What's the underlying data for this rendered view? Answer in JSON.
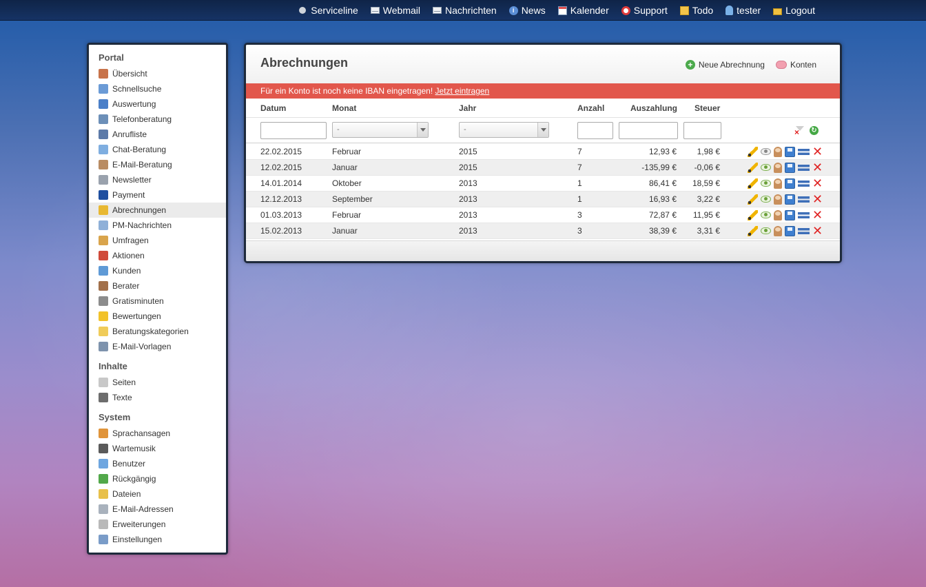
{
  "topnav": [
    {
      "label": "Serviceline",
      "icon": "status-dot-icon"
    },
    {
      "label": "Webmail",
      "icon": "webmail-icon"
    },
    {
      "label": "Nachrichten",
      "icon": "envelope-icon"
    },
    {
      "label": "News",
      "icon": "info-icon"
    },
    {
      "label": "Kalender",
      "icon": "calendar-icon"
    },
    {
      "label": "Support",
      "icon": "lifebuoy-icon"
    },
    {
      "label": "Todo",
      "icon": "note-icon"
    },
    {
      "label": "tester",
      "icon": "user-icon"
    },
    {
      "label": "Logout",
      "icon": "lock-icon"
    }
  ],
  "sidebar": {
    "portal_title": "Portal",
    "portal_items": [
      {
        "label": "Übersicht",
        "color": "#c8734a"
      },
      {
        "label": "Schnellsuche",
        "color": "#6b9bd6"
      },
      {
        "label": "Auswertung",
        "color": "#4a7fc8"
      },
      {
        "label": "Telefonberatung",
        "color": "#6c8fb8"
      },
      {
        "label": "Anrufliste",
        "color": "#5c7aa8"
      },
      {
        "label": "Chat-Beratung",
        "color": "#7faee0"
      },
      {
        "label": "E-Mail-Beratung",
        "color": "#b98c63"
      },
      {
        "label": "Newsletter",
        "color": "#9aa2ad"
      },
      {
        "label": "Payment",
        "color": "#1f4fa0"
      },
      {
        "label": "Abrechnungen",
        "color": "#e8b832"
      },
      {
        "label": "PM-Nachrichten",
        "color": "#8fb0d8"
      },
      {
        "label": "Umfragen",
        "color": "#d9a44c"
      },
      {
        "label": "Aktionen",
        "color": "#d04a3a"
      },
      {
        "label": "Kunden",
        "color": "#5f9ad6"
      },
      {
        "label": "Berater",
        "color": "#a2704a"
      },
      {
        "label": "Gratisminuten",
        "color": "#8c8c8c"
      },
      {
        "label": "Bewertungen",
        "color": "#f2c22a"
      },
      {
        "label": "Beratungskategorien",
        "color": "#f0cc5a"
      },
      {
        "label": "E-Mail-Vorlagen",
        "color": "#7e93ad"
      }
    ],
    "active_item": "Abrechnungen",
    "inhalte_title": "Inhalte",
    "inhalte_items": [
      {
        "label": "Seiten",
        "color": "#c8c8c8"
      },
      {
        "label": "Texte",
        "color": "#6d6d6d"
      }
    ],
    "system_title": "System",
    "system_items": [
      {
        "label": "Sprachansagen",
        "color": "#e0943a"
      },
      {
        "label": "Wartemusik",
        "color": "#5a5a5a"
      },
      {
        "label": "Benutzer",
        "color": "#6ea6e0"
      },
      {
        "label": "Rückgängig",
        "color": "#52a84a"
      },
      {
        "label": "Dateien",
        "color": "#e8c04a"
      },
      {
        "label": "E-Mail-Adressen",
        "color": "#a9b2bd"
      },
      {
        "label": "Erweiterungen",
        "color": "#b9b9b9"
      },
      {
        "label": "Einstellungen",
        "color": "#7a9cc8"
      }
    ]
  },
  "main": {
    "title": "Abrechnungen",
    "new_button": "Neue Abrechnung",
    "accounts_button": "Konten",
    "alert_text": "Für ein Konto ist noch keine IBAN eingetragen!",
    "alert_link": "Jetzt eintragen",
    "columns": {
      "datum": "Datum",
      "monat": "Monat",
      "jahr": "Jahr",
      "anzahl": "Anzahl",
      "auszahlung": "Auszahlung",
      "steuer": "Steuer"
    },
    "filters": {
      "monat_selected": "-",
      "jahr_selected": "-"
    },
    "rows": [
      {
        "datum": "22.02.2015",
        "monat": "Februar",
        "jahr": "2015",
        "anzahl": "7",
        "auszahlung": "12,93 €",
        "steuer": "1,98 €",
        "viewed": false
      },
      {
        "datum": "12.02.2015",
        "monat": "Januar",
        "jahr": "2015",
        "anzahl": "7",
        "auszahlung": "-135,99 €",
        "steuer": "-0,06 €",
        "viewed": true
      },
      {
        "datum": "14.01.2014",
        "monat": "Oktober",
        "jahr": "2013",
        "anzahl": "1",
        "auszahlung": "86,41 €",
        "steuer": "18,59 €",
        "viewed": true
      },
      {
        "datum": "12.12.2013",
        "monat": "September",
        "jahr": "2013",
        "anzahl": "1",
        "auszahlung": "16,93 €",
        "steuer": "3,22 €",
        "viewed": true
      },
      {
        "datum": "01.03.2013",
        "monat": "Februar",
        "jahr": "2013",
        "anzahl": "3",
        "auszahlung": "72,87 €",
        "steuer": "11,95 €",
        "viewed": true
      },
      {
        "datum": "15.02.2013",
        "monat": "Januar",
        "jahr": "2013",
        "anzahl": "3",
        "auszahlung": "38,39 €",
        "steuer": "3,31 €",
        "viewed": true
      }
    ]
  }
}
